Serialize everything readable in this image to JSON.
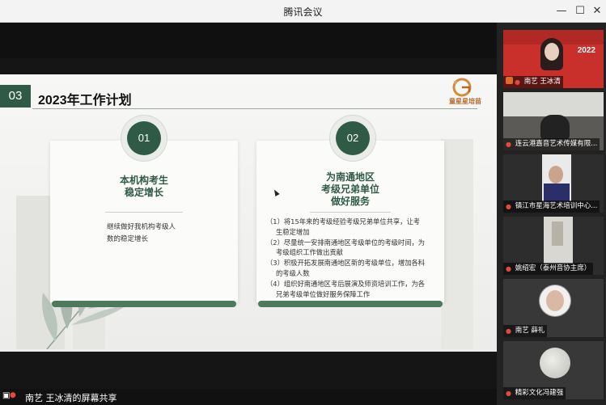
{
  "window": {
    "title": "腾讯会议",
    "minimize_icon": "minimize-icon",
    "maximize_icon": "maximize-icon",
    "close_icon": "close-icon"
  },
  "slide": {
    "section_number": "03",
    "title": "2023年工作计划",
    "logo_text": "童星星培苗",
    "cards": [
      {
        "number": "01",
        "heading_line1": "本机构考生",
        "heading_line2": "稳定增长",
        "body": [
          "继续做好我机构考级人",
          "数的稳定增长"
        ]
      },
      {
        "number": "02",
        "heading_line1": "为南通地区",
        "heading_line2": "考级兄弟单位",
        "heading_line3": "做好服务",
        "body": [
          "（1）将15年来的考级经验考级兄弟单位共享，让考",
          "生稳定增加",
          "（2）尽量统一安排南通地区考级单位的考级时间，为",
          "考级组织工作做出贡献",
          "（3）积极开拓发展南通地区新的考级单位，增加各科",
          "的考级人数",
          "（4）组织好南通地区考后展演及师资培训工作，为各",
          "兄弟考级单位做好服务保障工作"
        ]
      }
    ]
  },
  "share_bar": {
    "label": "南艺 王冰清的屏幕共享"
  },
  "participants": [
    {
      "name": "南艺 王冰清",
      "banner": "2022"
    },
    {
      "name": "连云港嘉音艺术传媒有限..."
    },
    {
      "name": "镇江市星海艺术培训中心..."
    },
    {
      "name": "姚绍宏（泰州音协主席）"
    },
    {
      "name": "南艺 薛礼"
    },
    {
      "name": "精彩文化冯建强"
    }
  ],
  "colors": {
    "accent_green": "#2f5b46",
    "bar_green": "#4d7a5d",
    "logo_orange": "#b36a2c"
  }
}
